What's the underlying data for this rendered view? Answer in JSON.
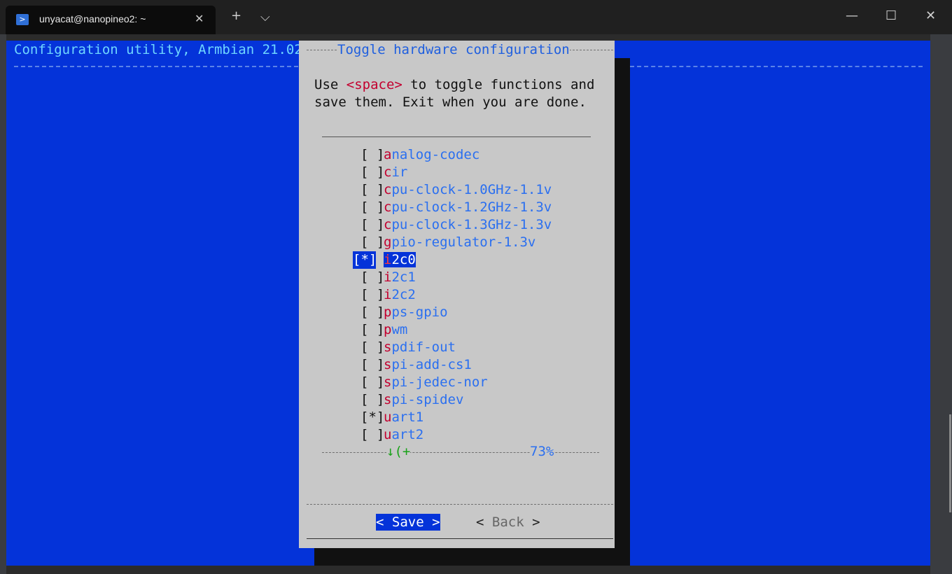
{
  "window": {
    "tab_title": "unyacat@nanopineo2: ~",
    "tab_icon": ">",
    "close_tab": "✕",
    "new_tab": "+",
    "dropdown": "⌵",
    "minimize": "—",
    "maximize": "☐",
    "close": "✕"
  },
  "header": {
    "text": "Configuration utility, Armbian 21.02."
  },
  "dialog": {
    "title": "Toggle hardware configuration",
    "description_line1_pre": "Use ",
    "description_key": "<space>",
    "description_line1_post": " to toggle functions and",
    "description_line2": "save them. Exit when you are done.",
    "items": [
      {
        "mark": "[ ]",
        "first": "a",
        "rest": "nalog-codec",
        "selected": false
      },
      {
        "mark": "[ ]",
        "first": "c",
        "rest": "ir",
        "selected": false
      },
      {
        "mark": "[ ]",
        "first": "c",
        "rest": "pu-clock-1.0GHz-1.1v",
        "selected": false
      },
      {
        "mark": "[ ]",
        "first": "c",
        "rest": "pu-clock-1.2GHz-1.3v",
        "selected": false
      },
      {
        "mark": "[ ]",
        "first": "c",
        "rest": "pu-clock-1.3GHz-1.3v",
        "selected": false
      },
      {
        "mark": "[ ]",
        "first": "g",
        "rest": "pio-regulator-1.3v",
        "selected": false
      },
      {
        "mark": "[*]",
        "first": "i",
        "rest": "2c0",
        "selected": true
      },
      {
        "mark": "[ ]",
        "first": "i",
        "rest": "2c1",
        "selected": false
      },
      {
        "mark": "[ ]",
        "first": "i",
        "rest": "2c2",
        "selected": false
      },
      {
        "mark": "[ ]",
        "first": "p",
        "rest": "ps-gpio",
        "selected": false
      },
      {
        "mark": "[ ]",
        "first": "p",
        "rest": "wm",
        "selected": false
      },
      {
        "mark": "[ ]",
        "first": "s",
        "rest": "pdif-out",
        "selected": false
      },
      {
        "mark": "[ ]",
        "first": "s",
        "rest": "pi-add-cs1",
        "selected": false
      },
      {
        "mark": "[ ]",
        "first": "s",
        "rest": "pi-jedec-nor",
        "selected": false
      },
      {
        "mark": "[ ]",
        "first": "s",
        "rest": "pi-spidev",
        "selected": false
      },
      {
        "mark": "[*]",
        "first": "u",
        "rest": "art1",
        "selected": false
      },
      {
        "mark": "[ ]",
        "first": "u",
        "rest": "art2",
        "selected": false
      }
    ],
    "scroll_indicator": "↓(+",
    "scroll_percent": "73%",
    "save_button": "< Save >",
    "back_button_left": "< ",
    "back_button_label": "Back",
    "back_button_right": " >"
  },
  "colors": {
    "terminal_bg": "#0433d9",
    "dialog_bg": "#c8c8c8",
    "hotkey": "#c3002f",
    "item_text": "#2a6ff0"
  }
}
